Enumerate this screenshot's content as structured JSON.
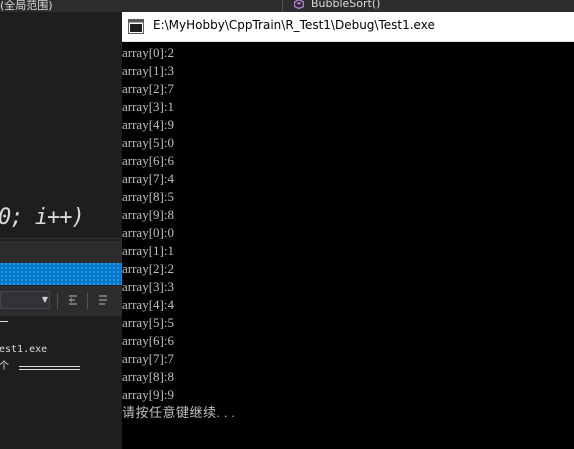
{
  "ide": {
    "scope_dropdown": "(全局范围)",
    "function_dropdown": "BubbleSort()",
    "code_fragment": "0;  i++)",
    "output_lines": [
      "est1.exe",
      "个"
    ]
  },
  "console": {
    "title": "E:\\MyHobby\\CppTrain\\R_Test1\\Debug\\Test1.exe",
    "lines": [
      "array[0]:2",
      "array[1]:3",
      "array[2]:7",
      "array[3]:1",
      "array[4]:9",
      "array[5]:0",
      "array[6]:6",
      "array[7]:4",
      "array[8]:5",
      "array[9]:8",
      "array[0]:0",
      "array[1]:1",
      "array[2]:2",
      "array[3]:3",
      "array[4]:4",
      "array[5]:5",
      "array[6]:6",
      "array[7]:7",
      "array[8]:8",
      "array[9]:9"
    ],
    "prompt": "请按任意键继续. . ."
  },
  "colors": {
    "console_bg": "#000000",
    "console_text": "#c0c0c0",
    "ide_bg": "#1e1e1e",
    "ide_accent": "#007acc",
    "func_icon": "#b180d7"
  },
  "icons": [
    "function-icon",
    "console-app-icon",
    "dropdown-arrow-icon",
    "go-to-previous-icon",
    "go-to-next-icon"
  ]
}
